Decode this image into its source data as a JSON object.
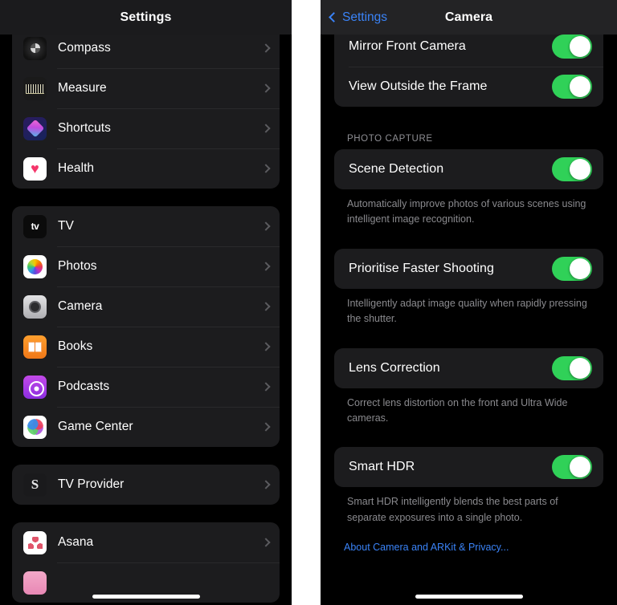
{
  "left_panel": {
    "nav": {
      "title": "Settings"
    },
    "groups": [
      {
        "id": "group-utilities",
        "rows": [
          {
            "label": "Compass",
            "icon": "compass-icon"
          },
          {
            "label": "Measure",
            "icon": "measure-icon"
          },
          {
            "label": "Shortcuts",
            "icon": "shortcuts-icon"
          },
          {
            "label": "Health",
            "icon": "health-icon"
          }
        ]
      },
      {
        "id": "group-apple-apps",
        "rows": [
          {
            "label": "TV",
            "icon": "apple-tv-icon"
          },
          {
            "label": "Photos",
            "icon": "photos-icon"
          },
          {
            "label": "Camera",
            "icon": "camera-icon"
          },
          {
            "label": "Books",
            "icon": "books-icon"
          },
          {
            "label": "Podcasts",
            "icon": "podcasts-icon"
          },
          {
            "label": "Game Center",
            "icon": "game-center-icon"
          }
        ]
      },
      {
        "id": "group-tv-provider",
        "rows": [
          {
            "label": "TV Provider",
            "icon": "tv-provider-icon"
          }
        ]
      },
      {
        "id": "group-third-party",
        "rows": [
          {
            "label": "Asana",
            "icon": "asana-icon"
          }
        ]
      }
    ]
  },
  "right_panel": {
    "nav": {
      "back_label": "Settings",
      "title": "Camera",
      "back_icon": "chevron-left-icon"
    },
    "top_group": {
      "rows": [
        {
          "label": "Mirror Front Camera",
          "toggle": "on"
        },
        {
          "label": "View Outside the Frame",
          "toggle": "on"
        }
      ]
    },
    "photo_capture": {
      "header": "PHOTO CAPTURE",
      "items": [
        {
          "label": "Scene Detection",
          "toggle": "on",
          "footnote": "Automatically improve photos of various scenes using intelligent image recognition."
        },
        {
          "label": "Prioritise Faster Shooting",
          "toggle": "on",
          "footnote": "Intelligently adapt image quality when rapidly pressing the shutter."
        },
        {
          "label": "Lens Correction",
          "toggle": "on",
          "footnote": "Correct lens distortion on the front and Ultra Wide cameras."
        },
        {
          "label": "Smart HDR",
          "toggle": "on",
          "footnote": "Smart HDR intelligently blends the best parts of separate exposures into a single photo."
        }
      ],
      "privacy_link": "About Camera and ARKit & Privacy..."
    }
  },
  "colors": {
    "background": "#000000",
    "card": "#1c1c1e",
    "toggle_on": "#30d158",
    "accent_link": "#3a83f7",
    "secondary_text": "#8e8e93"
  }
}
